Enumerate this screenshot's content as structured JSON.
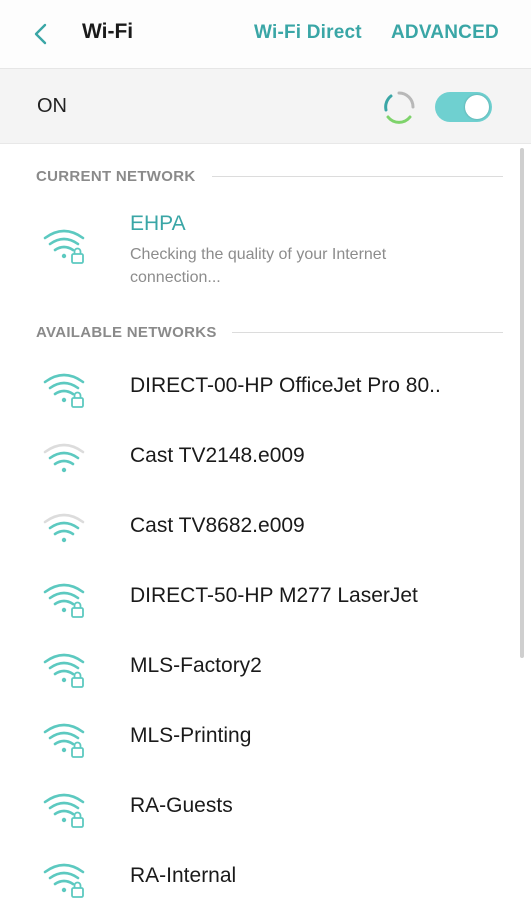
{
  "header": {
    "title": "Wi-Fi",
    "wifi_direct_label": "Wi-Fi Direct",
    "advanced_label": "ADVANCED"
  },
  "status_row": {
    "label": "ON",
    "toggle_on": true
  },
  "current_section": {
    "label": "CURRENT NETWORK",
    "network": {
      "name": "EHPA",
      "status": "Checking the quality of your Internet connection...",
      "icon": "wifi-lock-icon"
    }
  },
  "available_section": {
    "label": "AVAILABLE NETWORKS",
    "networks": [
      {
        "name": "DIRECT-00-HP OfficeJet Pro 80..",
        "icon": "wifi-lock-icon",
        "secured": true
      },
      {
        "name": "Cast TV2148.e009",
        "icon": "wifi-icon",
        "secured": false
      },
      {
        "name": "Cast TV8682.e009",
        "icon": "wifi-icon",
        "secured": false
      },
      {
        "name": "DIRECT-50-HP M277 LaserJet",
        "icon": "wifi-lock-icon",
        "secured": true
      },
      {
        "name": "MLS-Factory2",
        "icon": "wifi-lock-icon",
        "secured": true
      },
      {
        "name": "MLS-Printing",
        "icon": "wifi-lock-icon",
        "secured": true
      },
      {
        "name": "RA-Guests",
        "icon": "wifi-lock-icon",
        "secured": true
      },
      {
        "name": "RA-Internal",
        "icon": "wifi-lock-icon",
        "secured": true
      }
    ]
  },
  "colors": {
    "accent": "#3aa6a6",
    "toggle_track": "#6fd0d0",
    "section_label": "#8a8a8a",
    "wifi_strong": "#5cc9c0",
    "wifi_weak": "#dcdcdc"
  }
}
